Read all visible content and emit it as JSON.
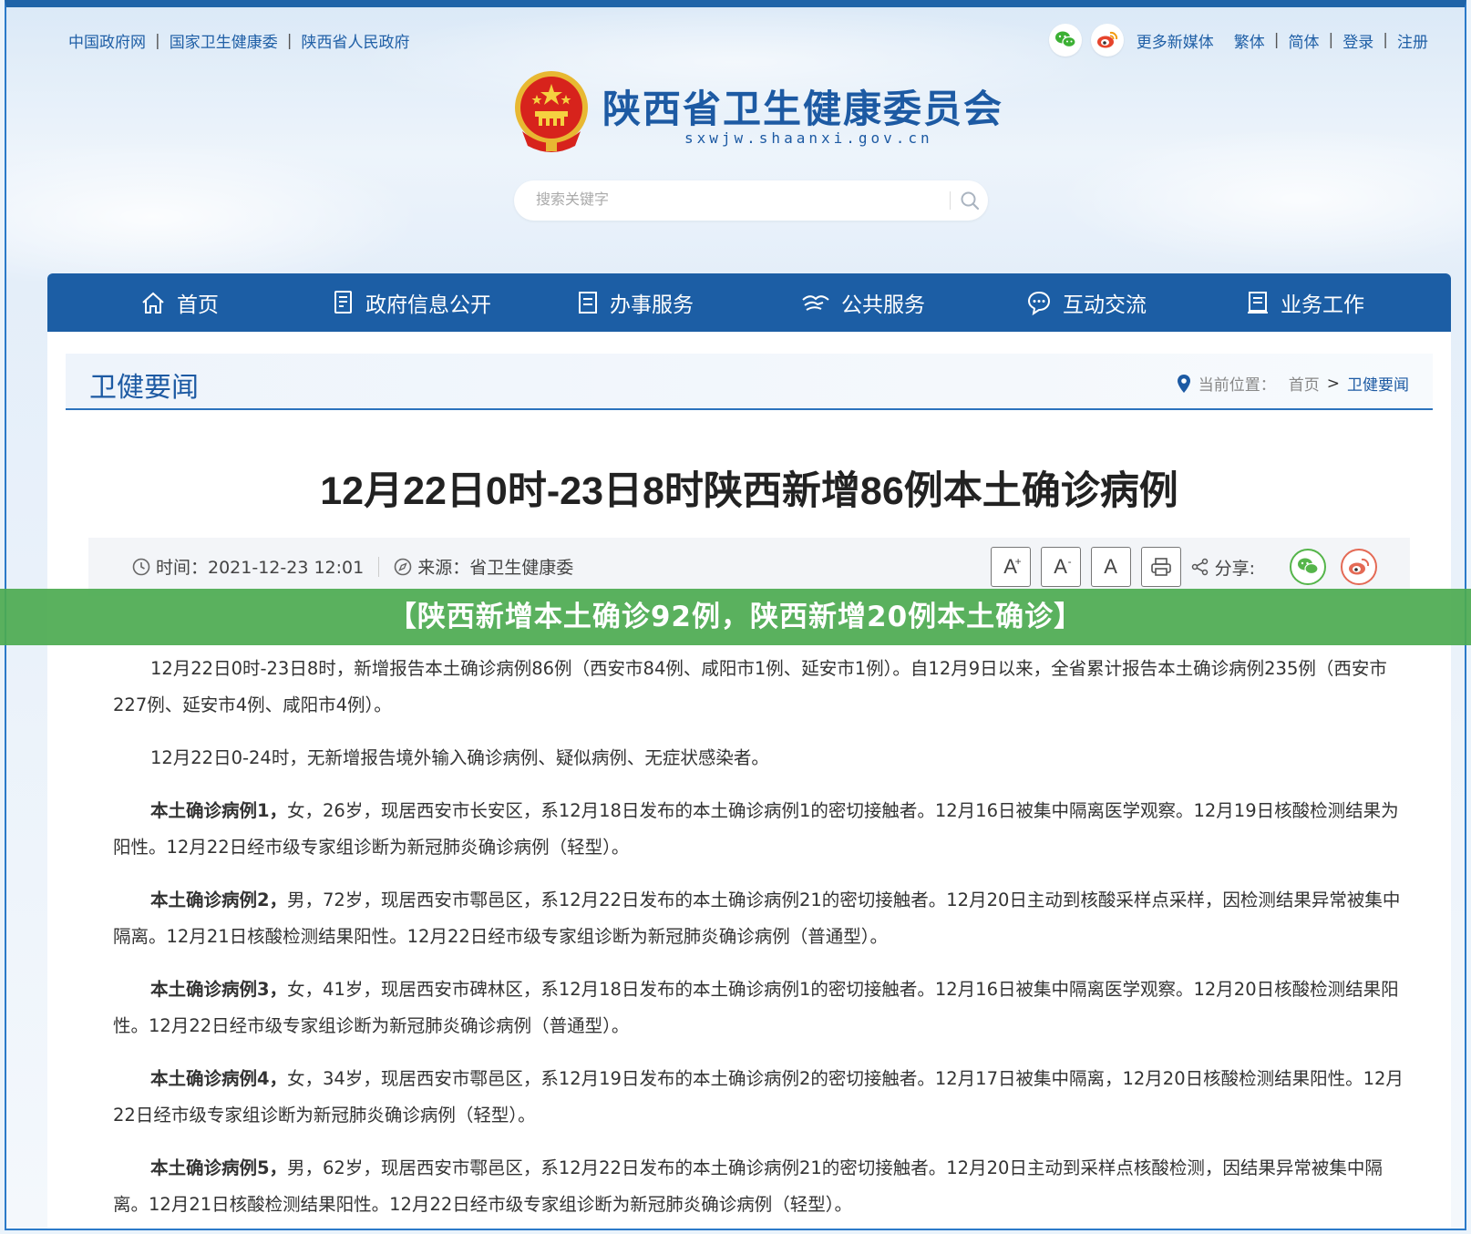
{
  "topbar": {
    "links": [
      "中国政府网",
      "国家卫生健康委",
      "陕西省人民政府"
    ],
    "sep": "|",
    "media_label": "更多新媒体",
    "traditional": "繁体",
    "simplified": "简体",
    "login": "登录",
    "register": "注册"
  },
  "logo": {
    "title": "陕西省卫生健康委员会",
    "domain": "sxwjw.shaanxi.gov.cn"
  },
  "search": {
    "placeholder": "搜索关键字"
  },
  "nav": {
    "items": [
      "首页",
      "政府信息公开",
      "办事服务",
      "公共服务",
      "互动交流",
      "业务工作"
    ]
  },
  "section": {
    "title": "卫健要闻",
    "breadcrumb_label": "当前位置：",
    "home": "首页",
    "sep": ">",
    "current": "卫健要闻"
  },
  "article": {
    "title": "12月22日0时-23日8时陕西新增86例本土确诊病例",
    "time": "时间：2021-12-23 12:01",
    "source": "来源：省卫生健康委",
    "font_large": "A",
    "font_large_sup": "+",
    "font_small": "A",
    "font_small_sup": "-",
    "font_default": "A",
    "share_label": "分享:",
    "paragraphs": [
      {
        "lead": "",
        "text": "12月22日0时-23日8时，新增报告本土确诊病例86例（西安市84例、咸阳市1例、延安市1例）。自12月9日以来，全省累计报告本土确诊病例235例（西安市227例、延安市4例、咸阳市4例）。"
      },
      {
        "lead": "",
        "text": "12月22日0-24时，无新增报告境外输入确诊病例、疑似病例、无症状感染者。"
      },
      {
        "lead": "本土确诊病例1，",
        "text": "女，26岁，现居西安市长安区，系12月18日发布的本土确诊病例1的密切接触者。12月16日被集中隔离医学观察。12月19日核酸检测结果为阳性。12月22日经市级专家组诊断为新冠肺炎确诊病例（轻型）。"
      },
      {
        "lead": "本土确诊病例2，",
        "text": "男，72岁，现居西安市鄠邑区，系12月22日发布的本土确诊病例21的密切接触者。12月20日主动到核酸采样点采样，因检测结果异常被集中隔离。12月21日核酸检测结果阳性。12月22日经市级专家组诊断为新冠肺炎确诊病例（普通型）。"
      },
      {
        "lead": "本土确诊病例3，",
        "text": "女，41岁，现居西安市碑林区，系12月18日发布的本土确诊病例1的密切接触者。12月16日被集中隔离医学观察。12月20日核酸检测结果阳性。12月22日经市级专家组诊断为新冠肺炎确诊病例（普通型）。"
      },
      {
        "lead": "本土确诊病例4，",
        "text": "女，34岁，现居西安市鄠邑区，系12月19日发布的本土确诊病例2的密切接触者。12月17日被集中隔离，12月20日核酸检测结果阳性。12月22日经市级专家组诊断为新冠肺炎确诊病例（轻型）。"
      },
      {
        "lead": "本土确诊病例5，",
        "text": "男，62岁，现居西安市鄠邑区，系12月22日发布的本土确诊病例21的密切接触者。12月20日主动到采样点核酸检测，因结果异常被集中隔离。12月21日核酸检测结果阳性。12月22日经市级专家组诊断为新冠肺炎确诊病例（轻型）。"
      }
    ]
  },
  "banner": {
    "text": "【陕西新增本土确诊92例，陕西新增20例本土确诊】"
  },
  "colors": {
    "brand_blue": "#1c5ea5",
    "banner_green": "#4caa50",
    "wechat_green": "#55b54a",
    "weibo_red": "#e46a55"
  }
}
